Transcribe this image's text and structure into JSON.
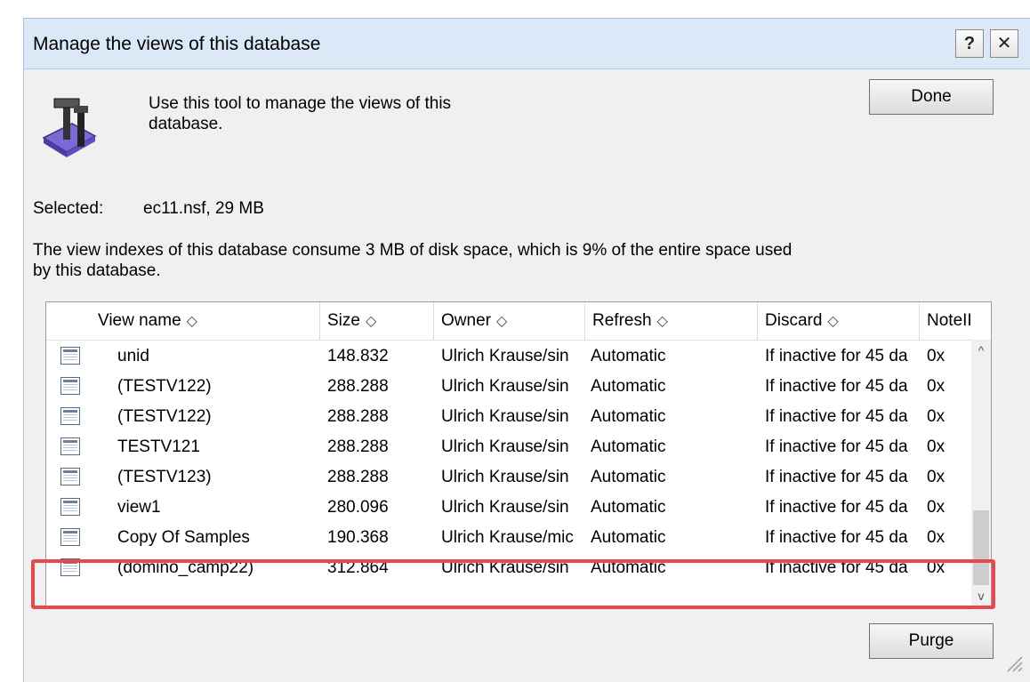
{
  "dialog": {
    "title": "Manage the views of this database",
    "help_label": "?",
    "close_label": "✕"
  },
  "intro_text": "Use this tool to manage the views of this database.",
  "buttons": {
    "done": "Done",
    "purge": "Purge"
  },
  "selected": {
    "label": "Selected:",
    "value": "ec11.nsf, 29 MB"
  },
  "info_text": "The view indexes of this database consume 3 MB of disk space, which is 9% of the entire space used by this database.",
  "table": {
    "columns": [
      "View name",
      "Size",
      "Owner",
      "Refresh",
      "Discard",
      "NoteII"
    ],
    "sort_glyph": "◇",
    "rows": [
      {
        "name": "unid",
        "size": "148.832",
        "owner": "Ulrich Krause/sin",
        "refresh": "Automatic",
        "discard": "If inactive for 45 da",
        "note": "0x"
      },
      {
        "name": "(TESTV122)",
        "size": "288.288",
        "owner": "Ulrich Krause/sin",
        "refresh": "Automatic",
        "discard": "If inactive for 45 da",
        "note": "0x"
      },
      {
        "name": "(TESTV122)",
        "size": "288.288",
        "owner": "Ulrich Krause/sin",
        "refresh": "Automatic",
        "discard": "If inactive for 45 da",
        "note": "0x"
      },
      {
        "name": "TESTV121",
        "size": "288.288",
        "owner": "Ulrich Krause/sin",
        "refresh": "Automatic",
        "discard": "If inactive for 45 da",
        "note": "0x"
      },
      {
        "name": "(TESTV123)",
        "size": "288.288",
        "owner": "Ulrich Krause/sin",
        "refresh": "Automatic",
        "discard": "If inactive for 45 da",
        "note": "0x"
      },
      {
        "name": "view1",
        "size": "280.096",
        "owner": "Ulrich Krause/sin",
        "refresh": "Automatic",
        "discard": "If inactive for 45 da",
        "note": "0x"
      },
      {
        "name": "Copy Of Samples",
        "size": "190.368",
        "owner": "Ulrich Krause/mic",
        "refresh": "Automatic",
        "discard": "If inactive for 45 da",
        "note": "0x"
      },
      {
        "name": "(domino_camp22)",
        "size": "312.864",
        "owner": "Ulrich Krause/sin",
        "refresh": "Automatic",
        "discard": "If inactive for 45 da",
        "note": "0x"
      }
    ]
  },
  "scrollbar": {
    "up_glyph": "^",
    "down_glyph": "v"
  },
  "colors": {
    "titlebar": "#dbe8f7",
    "highlight": "#e8474e",
    "dialog_bg": "#f0f0f0"
  }
}
